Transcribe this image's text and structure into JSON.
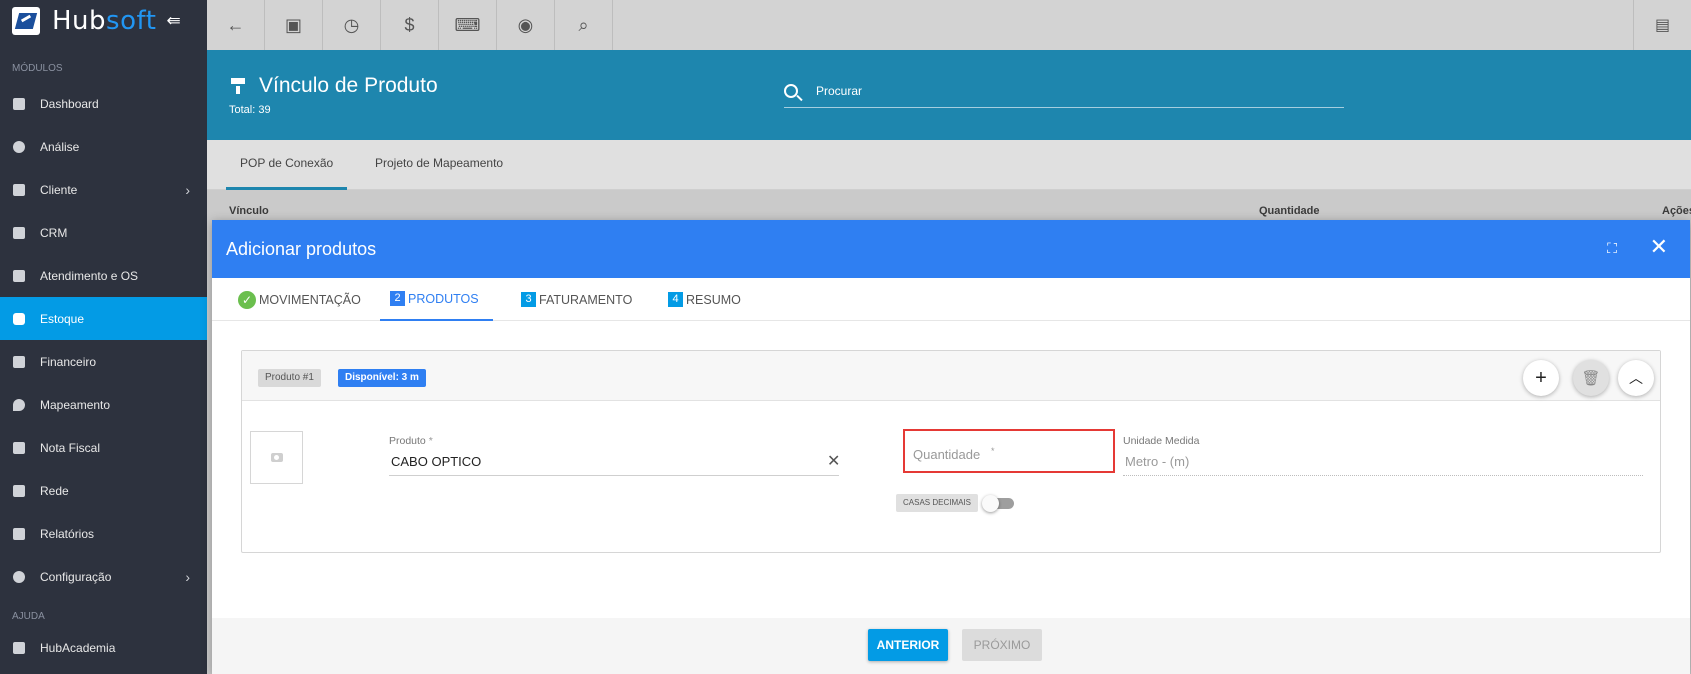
{
  "sidebar": {
    "logo_hub": "Hub",
    "logo_soft": "soft",
    "section_modules": "MÓDULOS",
    "items": [
      {
        "label": "Dashboard"
      },
      {
        "label": "Análise"
      },
      {
        "label": "Cliente"
      },
      {
        "label": "CRM"
      },
      {
        "label": "Atendimento e OS"
      },
      {
        "label": "Estoque"
      },
      {
        "label": "Financeiro"
      },
      {
        "label": "Mapeamento"
      },
      {
        "label": "Nota Fiscal"
      },
      {
        "label": "Rede"
      },
      {
        "label": "Relatórios"
      },
      {
        "label": "Configuração"
      }
    ],
    "section_help": "AJUDA",
    "help_items": [
      {
        "label": "HubAcademia"
      }
    ]
  },
  "header": {
    "title": "Vínculo de Produto",
    "total": "Total: 39",
    "search_placeholder": "Procurar"
  },
  "page_tabs": [
    "POP de Conexão",
    "Projeto de Mapeamento"
  ],
  "columns": [
    "Vínculo",
    "Quantidade",
    "Ações"
  ],
  "dialog": {
    "title": "Adicionar produtos",
    "steps": [
      {
        "num": "",
        "label": "MOVIMENTAÇÃO"
      },
      {
        "num": "2",
        "label": "PRODUTOS"
      },
      {
        "num": "3",
        "label": "FATURAMENTO"
      },
      {
        "num": "4",
        "label": "RESUMO"
      }
    ],
    "product": {
      "badge": "Produto #1",
      "available": "Disponível: 3 m",
      "produto_label": "Produto",
      "produto_value": "CABO OPTICO",
      "quantidade_placeholder": "Quantidade",
      "unidade_label": "Unidade Medida",
      "unidade_value": "Metro - (m)",
      "casas_label": "CASAS DECIMAIS",
      "required_mark": "*"
    },
    "footer": {
      "prev": "ANTERIOR",
      "next": "PRÓXIMO"
    }
  },
  "colors": {
    "sidebar_bg": "#2d323e",
    "active_item": "#039be5",
    "header_bg": "#1e86ae",
    "dialog_header": "#2f7ff2",
    "highlight": "#e53935"
  }
}
